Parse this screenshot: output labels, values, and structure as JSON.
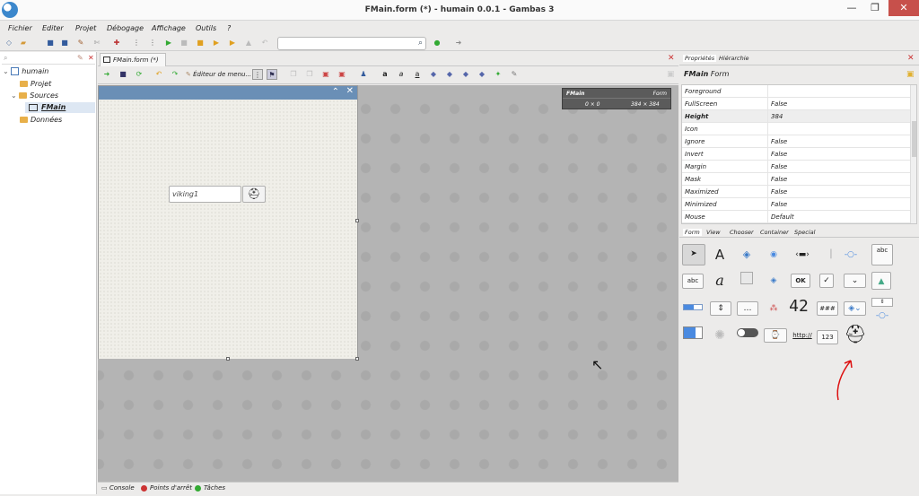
{
  "window": {
    "title": "FMain.form (*) - humain 0.0.1 - Gambas 3",
    "min_glyph": "—",
    "max_glyph": "❐",
    "close_glyph": "✕"
  },
  "menu": [
    "Fichier",
    "Editer",
    "Projet",
    "Débogage",
    "Affichage",
    "Outils",
    "?"
  ],
  "project_tree": {
    "root": "humain",
    "items": [
      "Projet",
      "Sources",
      "FMain",
      "Données"
    ]
  },
  "editor": {
    "tab_label": "FMain.form (*)",
    "menu_editor_label": "Éditeur de menu..."
  },
  "form": {
    "textbox_value": "viking1",
    "info_name": "FMain",
    "info_class": "Form",
    "info_pos": "0 × 0",
    "info_size": "384 × 384"
  },
  "status_tabs": [
    "Console",
    "Points d'arrêt",
    "Tâches"
  ],
  "right": {
    "tabs": [
      "Propriétés",
      "Hiérarchie"
    ],
    "object_name": "FMain",
    "object_class": "Form"
  },
  "properties": [
    {
      "name": "Foreground",
      "value": ""
    },
    {
      "name": "FullScreen",
      "value": "False"
    },
    {
      "name": "Height",
      "value": "384"
    },
    {
      "name": "Icon",
      "value": ""
    },
    {
      "name": "Ignore",
      "value": "False"
    },
    {
      "name": "Invert",
      "value": "False"
    },
    {
      "name": "Margin",
      "value": "False"
    },
    {
      "name": "Mask",
      "value": "False"
    },
    {
      "name": "Maximized",
      "value": "False"
    },
    {
      "name": "Minimized",
      "value": "False"
    },
    {
      "name": "Mouse",
      "value": "Default"
    }
  ],
  "toolbox_tabs": [
    "Form",
    "View",
    "Chooser",
    "Container",
    "Special"
  ],
  "toolbox_labels": {
    "label_tool": "A",
    "textarea": "abc",
    "textbox": "abc",
    "button": "OK",
    "lcd": "42",
    "masked": "###",
    "url": "http://",
    "value": "123"
  }
}
